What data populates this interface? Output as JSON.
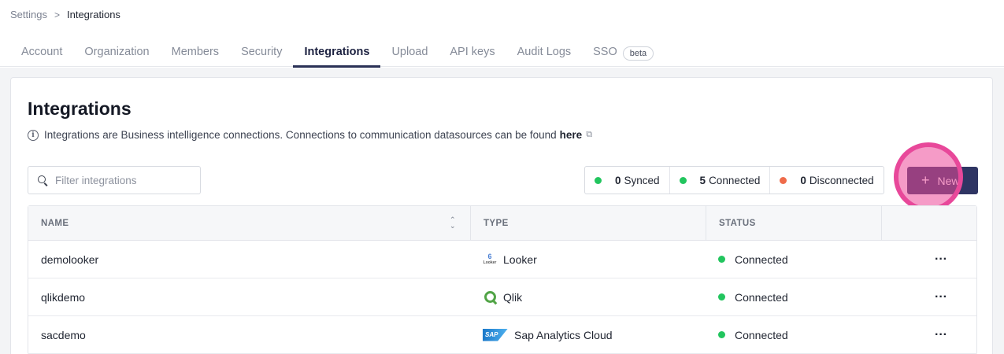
{
  "breadcrumb": {
    "parent": "Settings",
    "current": "Integrations"
  },
  "tabs": [
    {
      "label": "Account"
    },
    {
      "label": "Organization"
    },
    {
      "label": "Members"
    },
    {
      "label": "Security"
    },
    {
      "label": "Integrations"
    },
    {
      "label": "Upload"
    },
    {
      "label": "API keys"
    },
    {
      "label": "Audit Logs"
    },
    {
      "label": "SSO",
      "badge": "beta"
    }
  ],
  "page": {
    "title": "Integrations",
    "info_text": "Integrations are Business intelligence connections. Connections to communication datasources can be found",
    "info_link": "here"
  },
  "filter": {
    "placeholder": "Filter integrations",
    "value": ""
  },
  "summary": [
    {
      "count": "0",
      "label": "Synced",
      "color": "#22c55e"
    },
    {
      "count": "5",
      "label": "Connected",
      "color": "#22c55e"
    },
    {
      "count": "0",
      "label": "Disconnected",
      "color": "#ef6b4a"
    }
  ],
  "new_button": {
    "label": "New"
  },
  "table": {
    "headers": {
      "name": "NAME",
      "type": "TYPE",
      "status": "STATUS"
    },
    "rows": [
      {
        "name": "demolooker",
        "type": "Looker",
        "type_icon": "looker-icon",
        "status": "Connected"
      },
      {
        "name": "qlikdemo",
        "type": "Qlik",
        "type_icon": "qlik-icon",
        "status": "Connected"
      },
      {
        "name": "sacdemo",
        "type": "Sap Analytics Cloud",
        "type_icon": "sap-icon",
        "status": "Connected"
      }
    ]
  },
  "icons": {
    "looker_glyph": "6",
    "looker_caption": "Looker",
    "sap_glyph": "SAP"
  }
}
